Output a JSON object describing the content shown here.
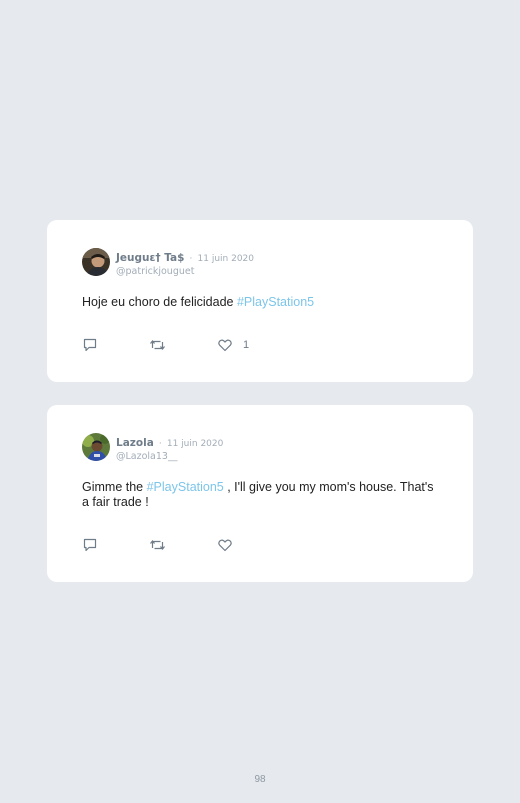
{
  "tweets": [
    {
      "author_name": "Jeuguɛ† Ta$",
      "separator": "·",
      "date": "11 juin 2020",
      "handle": "@patrickjouguet",
      "text_before": "Hoje eu choro de felicidade ",
      "hashtag": "#PlayStation5",
      "text_after": "",
      "likes": "1"
    },
    {
      "author_name": "Lazola",
      "separator": "·",
      "date": "11 juin 2020",
      "handle": "@Lazola13__",
      "text_before": "Gimme the ",
      "hashtag": "#PlayStation5",
      "text_after": " , I'll give you my mom's house. That's a fair trade !",
      "likes": ""
    }
  ],
  "icons": {
    "reply": "comment-icon",
    "retweet": "retweet-icon",
    "like": "heart-icon"
  },
  "colors": {
    "background": "#e6e9ed",
    "card": "#ffffff",
    "hashtag": "#7cc5ea",
    "muted": "#a2adb8",
    "name": "#6f7c89"
  },
  "page": {
    "number": "98"
  }
}
